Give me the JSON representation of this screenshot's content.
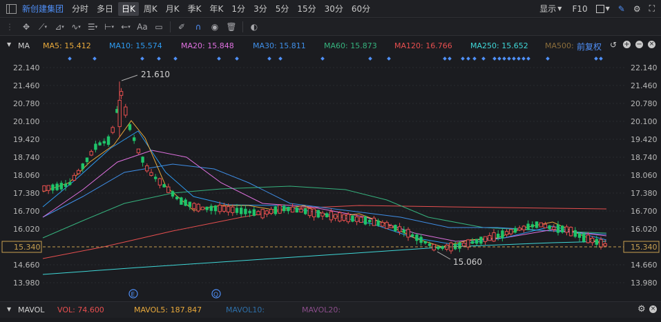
{
  "header": {
    "stock_name": "新创建集团",
    "periods": [
      "分时",
      "多日",
      "日K",
      "周K",
      "月K",
      "季K",
      "年K",
      "1分",
      "3分",
      "5分",
      "15分",
      "30分",
      "60分"
    ],
    "active_period": "日K",
    "display_label": "显示",
    "f10_label": "F10"
  },
  "toolbar": {
    "text_tool": "Aa"
  },
  "ma_bar": {
    "label": "MA",
    "items": [
      {
        "text": "MA5: 15.412",
        "color": "#e8a93b"
      },
      {
        "text": "MA10: 15.574",
        "color": "#2e9bf0"
      },
      {
        "text": "MA20: 15.848",
        "color": "#e071e0"
      },
      {
        "text": "MA30: 15.811",
        "color": "#3f8fe8"
      },
      {
        "text": "MA60: 15.873",
        "color": "#36b37e"
      },
      {
        "text": "MA120: 16.766",
        "color": "#e84f4f"
      },
      {
        "text": "MA250: 15.652",
        "color": "#3fd8d8"
      },
      {
        "text": "MA500:",
        "color": "#8a6d3b"
      }
    ],
    "adjust_label": "前复权"
  },
  "price_axis": {
    "ticks": [
      "22.140",
      "21.460",
      "20.780",
      "20.100",
      "19.420",
      "18.740",
      "18.060",
      "17.380",
      "16.700",
      "16.020",
      "15.340",
      "14.660",
      "13.980"
    ],
    "current_price": "15.340",
    "max_label": "21.610",
    "min_label": "15.060",
    "event_markers": [
      "E",
      "Q"
    ]
  },
  "vol_bar": {
    "label": "MAVOL",
    "items": [
      {
        "text": "VOL: 74.600",
        "color": "#e84f4f"
      },
      {
        "text": "MAVOL5: 187.847",
        "color": "#e8a93b"
      },
      {
        "text": "MAVOL10:",
        "color": "#2e6fa8"
      },
      {
        "text": "MAVOL20:",
        "color": "#8a4d8a"
      }
    ]
  },
  "colors": {
    "up": "#e84f4f",
    "down": "#1fc46a",
    "accent": "#3d8ef0"
  }
}
